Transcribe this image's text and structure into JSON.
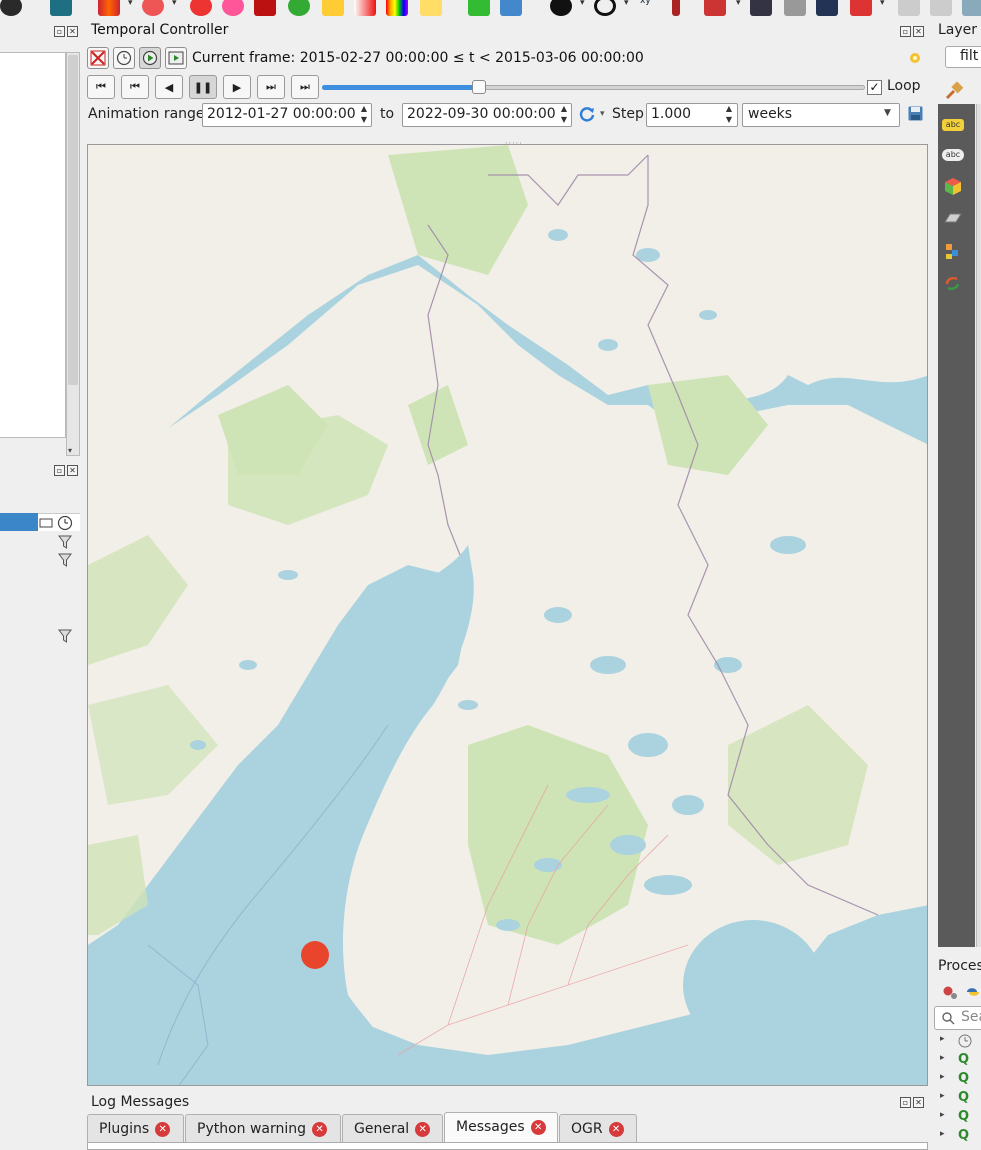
{
  "temporal_controller": {
    "title": "Temporal Controller",
    "current_frame_text": "Current frame: 2015-02-27 00:00:00 ≤ t < 2015-03-06 00:00:00",
    "slider_progress": 0.29,
    "loop_checked": true,
    "loop_label": "Loop",
    "animation_range_label": "Animation range",
    "range_start": "2012-01-27 00:00:00",
    "to_label": "to",
    "range_end": "2022-09-30 00:00:00",
    "step_label": "Step",
    "step_value": "1.000",
    "step_unit": "weeks",
    "playback_state": "playing"
  },
  "right_dock": {
    "layer_styling_title": "Layer S",
    "filter_placeholder": "filt",
    "processing_title": "Proces",
    "search_placeholder": "Sea"
  },
  "log_messages": {
    "title": "Log Messages",
    "tabs": [
      {
        "label": "Plugins",
        "active": false
      },
      {
        "label": "Python warning",
        "active": false
      },
      {
        "label": "General",
        "active": false
      },
      {
        "label": "Messages",
        "active": true
      },
      {
        "label": "OGR",
        "active": false
      }
    ]
  },
  "map": {
    "marker_color": "#e8452c",
    "water_color": "#aad3df",
    "land_color": "#f2efe9",
    "forest_color": "#cfe4b6"
  },
  "icons": {
    "toolbar": [
      "globe-icon",
      "bus-icon",
      "color-ramp-icon",
      "flower-icon",
      "heatmap-icon",
      "symbol-icon",
      "gradient-icon",
      "rainbow-icon",
      "picture-icon",
      "magnifier-icon",
      "shapes-icon",
      "circle-icon",
      "crosshair-icon",
      "xy-icon",
      "digitize-icon",
      "node-tool-icon",
      "measure-icon",
      "network-icon",
      "identify-icon"
    ]
  }
}
